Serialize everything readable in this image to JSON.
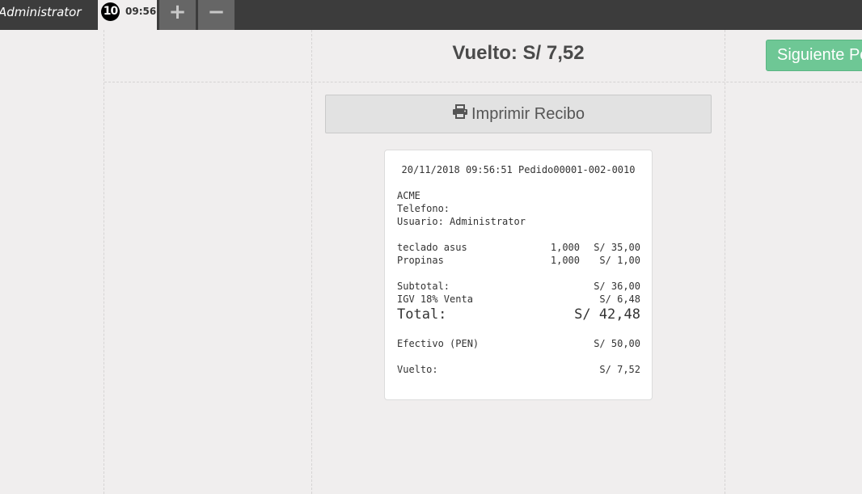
{
  "header": {
    "user": "Administrator",
    "order_number": "10",
    "order_time": "09:56",
    "add_label": "+",
    "remove_label": "−"
  },
  "payment": {
    "change_label": "Vuelto: S/ 7,52",
    "next_button": "Siguiente Pedido",
    "print_button": "Imprimir Recibo"
  },
  "receipt": {
    "header": "20/11/2018 09:56:51 Pedido00001-002-0010",
    "company": "ACME",
    "phone": "Telefono:",
    "user": "Usuario: Administrator",
    "lines": [
      {
        "name": "teclado asus",
        "qty": "1,000",
        "price": "S/ 35,00"
      },
      {
        "name": "Propinas",
        "qty": "1,000",
        "price": "S/ 1,00"
      }
    ],
    "subtotal_label": "Subtotal:",
    "subtotal_value": "S/ 36,00",
    "tax_label": "IGV 18% Venta",
    "tax_value": "S/ 6,48",
    "total_label": "Total:",
    "total_value": "S/ 42,48",
    "payment_label": "Efectivo (PEN)",
    "payment_value": "S/ 50,00",
    "change_label": "Vuelto:",
    "change_value": "S/ 7,52"
  }
}
